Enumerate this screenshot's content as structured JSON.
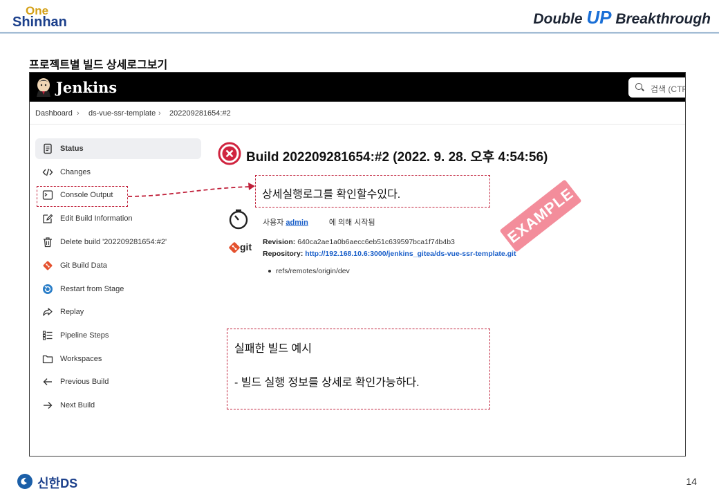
{
  "slide": {
    "logo_top": "One",
    "logo_bottom": "Shinhan",
    "brand_pre": "Double ",
    "brand_up": "UP",
    "brand_post": " Breakthrough",
    "title": "프로젝트별 빌드 상세로그보기",
    "footer_brand": "신한DS",
    "page_number": "14"
  },
  "jenkins": {
    "title": "Jenkins",
    "search_placeholder": "검색 (CTRL",
    "breadcrumb": [
      "Dashboard",
      "ds-vue-ssr-template",
      "202209281654:#2"
    ],
    "sidebar": [
      {
        "label": "Status",
        "icon": "document-icon",
        "active": true
      },
      {
        "label": "Changes",
        "icon": "code-icon",
        "active": false
      },
      {
        "label": "Console Output",
        "icon": "terminal-icon",
        "active": false
      },
      {
        "label": "Edit Build Information",
        "icon": "edit-icon",
        "active": false
      },
      {
        "label": "Delete build '202209281654:#2'",
        "icon": "trash-icon",
        "active": false
      },
      {
        "label": "Git Build Data",
        "icon": "git-icon",
        "active": false
      },
      {
        "label": "Restart from Stage",
        "icon": "restart-icon",
        "active": false
      },
      {
        "label": "Replay",
        "icon": "replay-icon",
        "active": false
      },
      {
        "label": "Pipeline Steps",
        "icon": "list-icon",
        "active": false
      },
      {
        "label": "Workspaces",
        "icon": "folder-icon",
        "active": false
      },
      {
        "label": "Previous Build",
        "icon": "arrow-left-icon",
        "active": false
      },
      {
        "label": "Next Build",
        "icon": "arrow-right-icon",
        "active": false
      }
    ],
    "build_title": "Build 202209281654:#2 (2022. 9. 28. 오후 4:54:56)",
    "started_prefix": "사용자 ",
    "started_user": "admin",
    "started_suffix": "에 의해 시작됨",
    "git_label": "git",
    "revision_label": "Revision:",
    "revision_value": "640ca2ae1a0b6aecc6eb51c639597bca1f74b4b3",
    "repository_label": "Repository:",
    "repository_url": "http://192.168.10.6:3000/jenkins_gitea/ds-vue-ssr-template.git",
    "ref": "refs/remotes/origin/dev"
  },
  "annotations": {
    "note1": "상세실행로그를 확인할수있다.",
    "note2_line1": "실패한 빌드 예시",
    "note2_line2": "- 빌드 실행 정보를 상세로 확인가능하다.",
    "stamp": "EXAMPLE"
  },
  "colors": {
    "accent_red": "#c0203a",
    "link_blue": "#1a5fc9",
    "brand_navy": "#1b3f8b"
  }
}
